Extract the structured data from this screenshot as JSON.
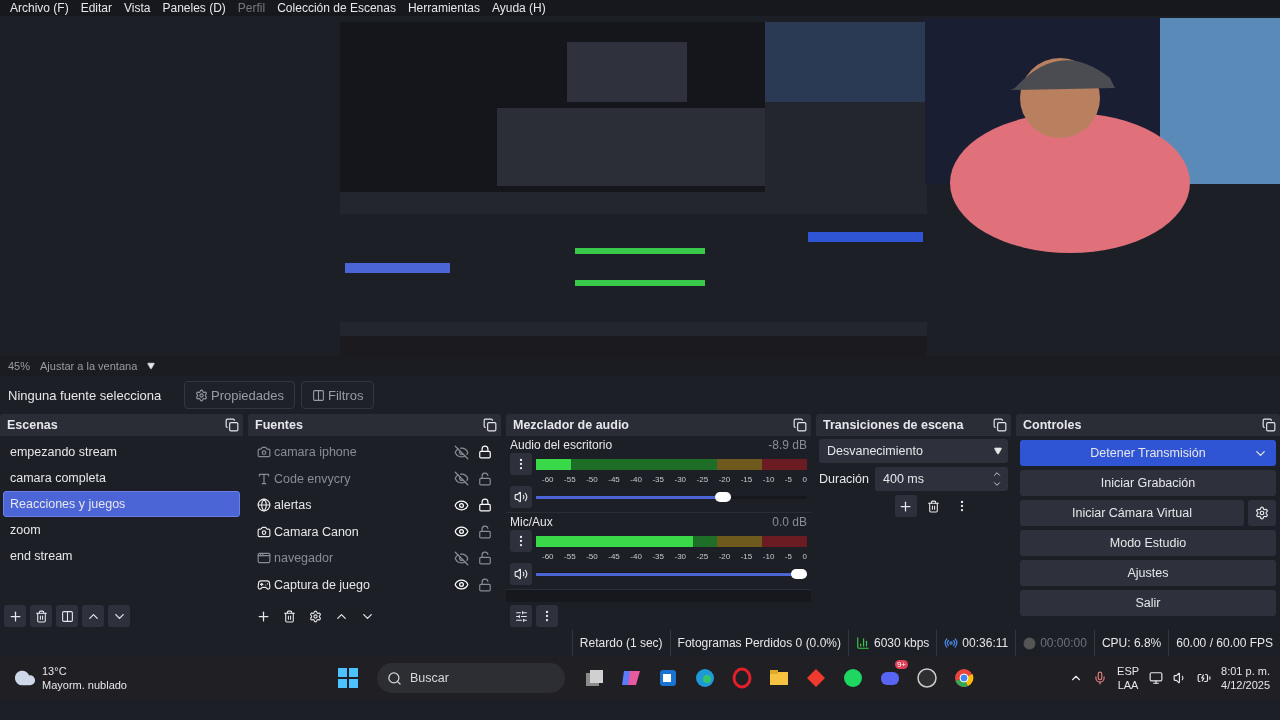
{
  "menu": [
    {
      "label": "Archivo (F)",
      "disabled": false
    },
    {
      "label": "Editar",
      "disabled": false
    },
    {
      "label": "Vista",
      "disabled": false
    },
    {
      "label": "Paneles (D)",
      "disabled": false
    },
    {
      "label": "Perfil",
      "disabled": true
    },
    {
      "label": "Colección de Escenas",
      "disabled": false
    },
    {
      "label": "Herramientas",
      "disabled": false
    },
    {
      "label": "Ayuda (H)",
      "disabled": false
    }
  ],
  "zoom_bar": {
    "zoom": "45%",
    "mode": "Ajustar a la ventana"
  },
  "source_toolbar": {
    "label": "Ninguna fuente selecciona",
    "buttons": [
      {
        "kind": "properties",
        "label": "Propiedades"
      },
      {
        "kind": "filters",
        "label": "Filtros"
      }
    ]
  },
  "scenes": {
    "title": "Escenas",
    "items": [
      {
        "name": "empezando stream",
        "selected": false
      },
      {
        "name": "camara completa",
        "selected": false
      },
      {
        "name": "Reacciones y juegos",
        "selected": true
      },
      {
        "name": "zoom",
        "selected": false
      },
      {
        "name": "end stream",
        "selected": false
      }
    ]
  },
  "sources": {
    "title": "Fuentes",
    "items": [
      {
        "name": "camara iphone",
        "kind": "camera",
        "visible": false,
        "locked": true
      },
      {
        "name": "Code envycry",
        "kind": "text",
        "visible": false,
        "locked": false
      },
      {
        "name": "alertas",
        "kind": "browser",
        "visible": true,
        "locked": true
      },
      {
        "name": "Camara Canon",
        "kind": "camera",
        "visible": true,
        "locked": false
      },
      {
        "name": "navegador",
        "kind": "window",
        "visible": false,
        "locked": false
      },
      {
        "name": "Captura de juego",
        "kind": "game",
        "visible": true,
        "locked": false
      }
    ]
  },
  "mixer": {
    "title": "Mezclador de audio",
    "channels": [
      {
        "name": "Audio del escritorio",
        "reading": "-8.9 dB",
        "meter": {
          "level": 0.13
        },
        "volume": {
          "level": 0.72
        },
        "scale": [
          "-60",
          "-55",
          "-50",
          "-45",
          "-40",
          "-35",
          "-30",
          "-25",
          "-20",
          "-15",
          "-10",
          "-5",
          "0"
        ]
      },
      {
        "name": "Mic/Aux",
        "reading": "0.0 dB",
        "meter": {
          "level": 0.58
        },
        "volume": {
          "level": 1.0
        },
        "scale": [
          "-60",
          "-55",
          "-50",
          "-45",
          "-40",
          "-35",
          "-30",
          "-25",
          "-20",
          "-15",
          "-10",
          "-5",
          "0"
        ]
      }
    ]
  },
  "transitions": {
    "title": "Transiciones de escena",
    "transition": "Desvanecimiento",
    "duration_label": "Duración",
    "duration": "400 ms"
  },
  "controls": {
    "title": "Controles",
    "buttons": [
      {
        "label": "Detener Transmisión",
        "kind": "primary"
      },
      {
        "label": "Iniciar Grabación",
        "kind": "plain"
      },
      {
        "label": "Iniciar Cámara Virtual",
        "kind": "settings"
      },
      {
        "label": "Modo Estudio",
        "kind": "plain"
      },
      {
        "label": "Ajustes",
        "kind": "plain"
      },
      {
        "label": "Salir",
        "kind": "plain"
      }
    ]
  },
  "status_bar": {
    "delay": "Retardo (1 sec)",
    "dropped": "Fotogramas Perdidos 0 (0.0%)",
    "bitrate": "6030 kbps",
    "stream_time": "00:36:11",
    "streaming": true,
    "record_time": "00:00:00",
    "recording": false,
    "cpu": "CPU: 6.8%",
    "fps": "60.00 / 60.00 FPS"
  },
  "taskbar": {
    "temperature": "13°C",
    "weather": "Mayorm. nublado",
    "search": {
      "placeholder": "Buscar"
    },
    "apps": [
      {
        "kind": "start"
      },
      {
        "kind": "task-view"
      },
      {
        "kind": "copilot"
      },
      {
        "kind": "outlook"
      },
      {
        "kind": "edge"
      },
      {
        "kind": "opera"
      },
      {
        "kind": "folder"
      },
      {
        "kind": "diamond"
      },
      {
        "kind": "spotify"
      },
      {
        "kind": "discord",
        "badge": "9+"
      },
      {
        "kind": "obs"
      },
      {
        "kind": "chrome"
      }
    ],
    "language": "ESP",
    "layout": "LAA",
    "time": "8:01 p. m.",
    "date": "4/12/2025"
  }
}
